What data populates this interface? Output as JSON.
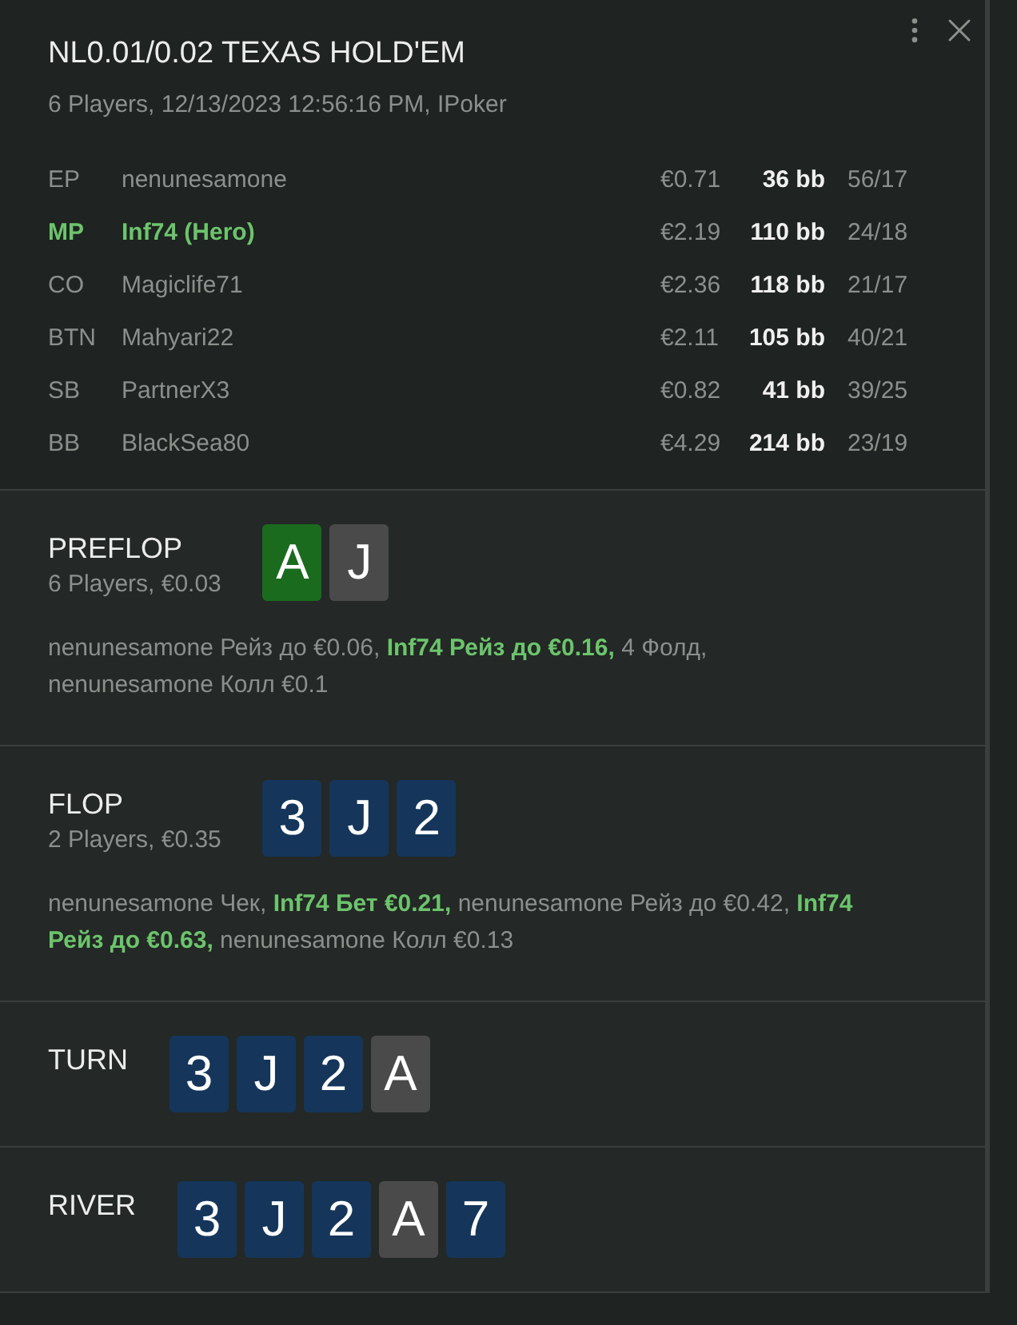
{
  "header": {
    "title": "NL0.01/0.02 TEXAS HOLD'EM",
    "subtitle": "6 Players, 12/13/2023 12:56:16 PM, IPoker"
  },
  "players": [
    {
      "position": "EP",
      "name": "nenunesamone",
      "stack": "€0.71",
      "bb": "36 bb",
      "stats": "56/17",
      "hero": false
    },
    {
      "position": "MP",
      "name": "Inf74 (Hero)",
      "stack": "€2.19",
      "bb": "110 bb",
      "stats": "24/18",
      "hero": true
    },
    {
      "position": "CO",
      "name": "Magiclife71",
      "stack": "€2.36",
      "bb": "118 bb",
      "stats": "21/17",
      "hero": false
    },
    {
      "position": "BTN",
      "name": "Mahyari22",
      "stack": "€2.11",
      "bb": "105 bb",
      "stats": "40/21",
      "hero": false
    },
    {
      "position": "SB",
      "name": "PartnerX3",
      "stack": "€0.82",
      "bb": "41 bb",
      "stats": "39/25",
      "hero": false
    },
    {
      "position": "BB",
      "name": "BlackSea80",
      "stack": "€4.29",
      "bb": "214 bb",
      "stats": "23/19",
      "hero": false
    }
  ],
  "streets": [
    {
      "name": "PREFLOP",
      "info": "6 Players, €0.03",
      "cards": [
        {
          "rank": "A",
          "color": "#1b6b1f"
        },
        {
          "rank": "J",
          "color": "#4a4a4a"
        }
      ],
      "actions": "nenunesamone Рейз до €0.06, **Inf74 Рейз до €0.16,** 4 Фолд, nenunesamone Колл €0.1"
    },
    {
      "name": "FLOP",
      "info": "2 Players, €0.35",
      "cards": [
        {
          "rank": "3",
          "color": "#15365a"
        },
        {
          "rank": "J",
          "color": "#15365a"
        },
        {
          "rank": "2",
          "color": "#15365a"
        }
      ],
      "actions": "nenunesamone Чек, **Inf74 Бет €0.21,** nenunesamone Рейз до €0.42, **Inf74 Рейз до €0.63,** nenunesamone Колл €0.13"
    },
    {
      "name": "TURN",
      "cards": [
        {
          "rank": "3",
          "color": "#15365a"
        },
        {
          "rank": "J",
          "color": "#15365a"
        },
        {
          "rank": "2",
          "color": "#15365a"
        },
        {
          "rank": "A",
          "color": "#4a4a4a"
        }
      ]
    },
    {
      "name": "RIVER",
      "cards": [
        {
          "rank": "3",
          "color": "#15365a"
        },
        {
          "rank": "J",
          "color": "#15365a"
        },
        {
          "rank": "2",
          "color": "#15365a"
        },
        {
          "rank": "A",
          "color": "#4a4a4a"
        },
        {
          "rank": "7",
          "color": "#15365a"
        }
      ]
    }
  ]
}
